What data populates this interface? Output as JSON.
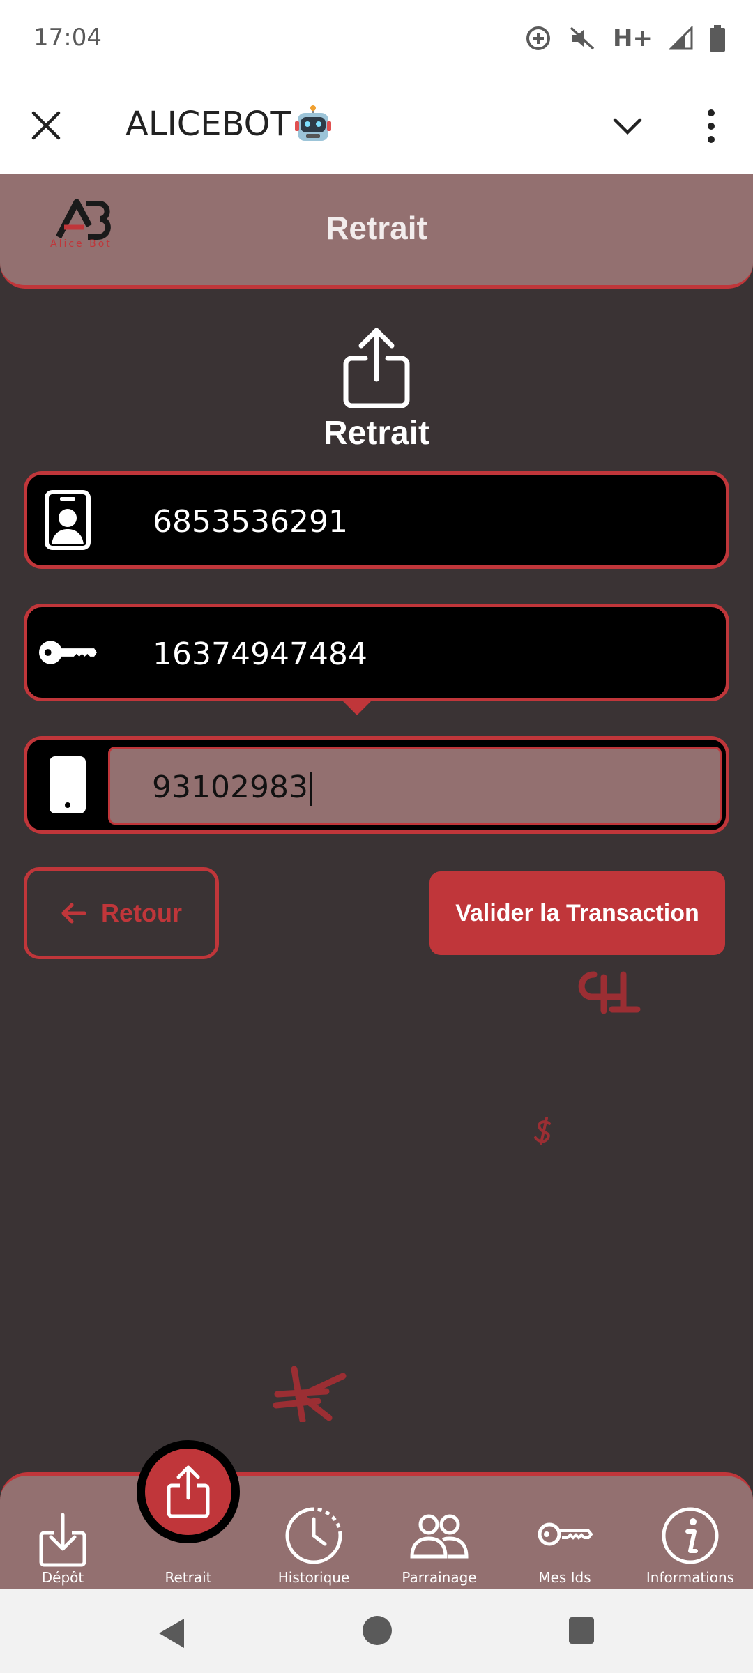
{
  "status_bar": {
    "time": "17:04",
    "network": "H+",
    "icons": [
      "data-saver-icon",
      "mute-icon",
      "signal-icon",
      "battery-icon"
    ]
  },
  "app_bar": {
    "title": "ALICEBOT",
    "icons": [
      "close-icon",
      "robot-emoji-icon",
      "chevron-down-icon",
      "more-vert-icon"
    ]
  },
  "header": {
    "logo_text": "Alice Bot",
    "title": "Retrait"
  },
  "hero": {
    "title": "Retrait",
    "icon": "share-upload-icon"
  },
  "fields": [
    {
      "icon": "id-badge-icon",
      "value": "6853536291"
    },
    {
      "icon": "key-icon",
      "value": "16374947484"
    },
    {
      "icon": "phone-icon",
      "value": "93102983"
    }
  ],
  "buttons": {
    "back_label": "Retour",
    "submit_label": "Valider la Transaction"
  },
  "bottom_nav": {
    "items": [
      {
        "label": "Dépôt",
        "icon": "download-icon"
      },
      {
        "label": "Retrait",
        "icon": "upload-icon"
      },
      {
        "label": "Historique",
        "icon": "clock-icon"
      },
      {
        "label": "Parrainage",
        "icon": "people-icon"
      },
      {
        "label": "Mes Ids",
        "icon": "key-icon"
      },
      {
        "label": "Informations",
        "icon": "info-icon"
      }
    ]
  },
  "colors": {
    "accent": "#c0363a",
    "header_bg": "#937070",
    "page_bg": "#3a3334"
  }
}
